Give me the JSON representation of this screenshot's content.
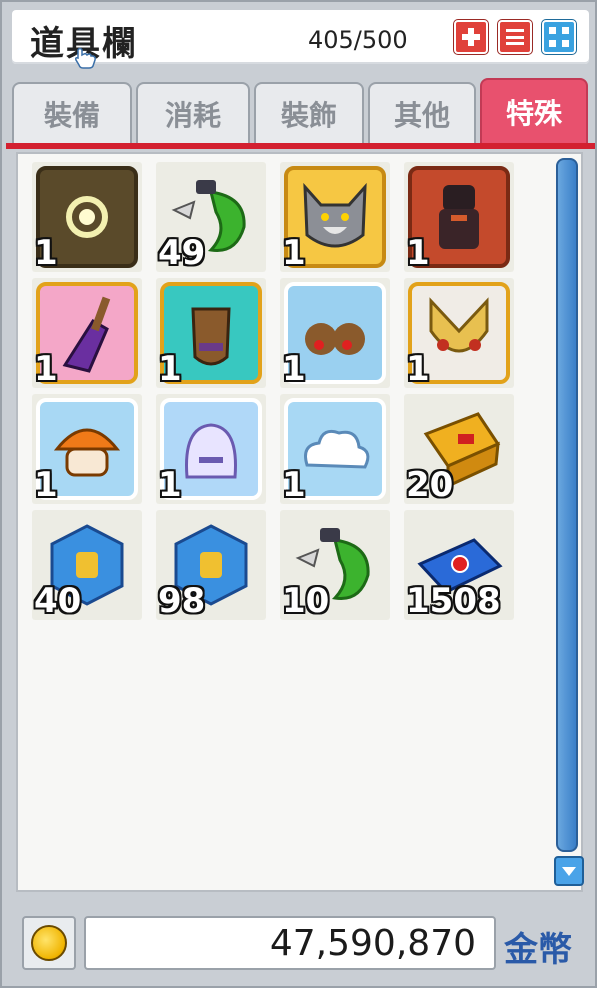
{
  "window": {
    "title": "道具欄",
    "capacity": "405/500"
  },
  "title_buttons": [
    {
      "icon": "plus-icon",
      "color": "#e0413a"
    },
    {
      "icon": "menu-icon",
      "color": "#e0413a"
    },
    {
      "icon": "expand-icon",
      "color": "#3aa2e0"
    }
  ],
  "tabs": [
    {
      "label": "裝備",
      "active": false
    },
    {
      "label": "消耗",
      "active": false
    },
    {
      "label": "裝飾",
      "active": false
    },
    {
      "label": "其他",
      "active": false
    },
    {
      "label": "特殊",
      "active": true
    }
  ],
  "items": [
    {
      "icon": "scroll-icon",
      "qty": "1"
    },
    {
      "icon": "green-potion-icon",
      "qty": "49"
    },
    {
      "icon": "wolf-icon",
      "qty": "1"
    },
    {
      "icon": "armor-icon",
      "qty": "1"
    },
    {
      "icon": "broom-icon",
      "qty": "1"
    },
    {
      "icon": "horse-icon",
      "qty": "1"
    },
    {
      "icon": "reindeer-icon",
      "qty": "1"
    },
    {
      "icon": "owl-icon",
      "qty": "1"
    },
    {
      "icon": "mushroom-icon",
      "qty": "1"
    },
    {
      "icon": "ghost-icon",
      "qty": "1"
    },
    {
      "icon": "cloud-icon",
      "qty": "1"
    },
    {
      "icon": "box-icon",
      "qty": "20"
    },
    {
      "icon": "blue-gem-icon",
      "qty": "40"
    },
    {
      "icon": "blue-gem-icon",
      "qty": "98"
    },
    {
      "icon": "green-potion-icon",
      "qty": "10"
    },
    {
      "icon": "ticket-icon",
      "qty": "1508"
    }
  ],
  "meso": {
    "amount": "47,590,870",
    "label": "金幣"
  },
  "colors": {
    "active_tab": "#e8516e",
    "tab_underline": "#d32030",
    "scrollbar": "#3a7fc8",
    "meso_label": "#2a5aa8"
  }
}
